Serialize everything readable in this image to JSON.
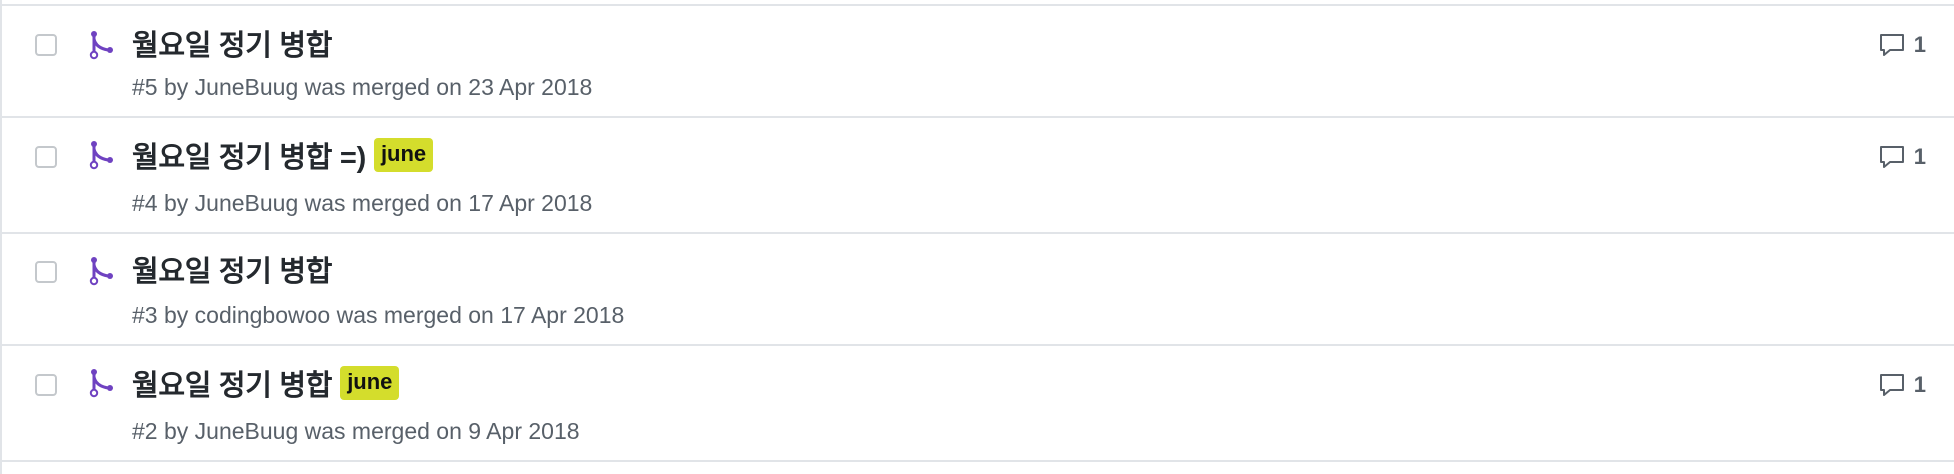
{
  "pull_requests": [
    {
      "title": "월요일 정기 병합",
      "label": "",
      "meta": "#5 by JuneBuug was merged on 23 Apr 2018",
      "comments": "1"
    },
    {
      "title": "월요일 정기 병합 =)",
      "label": "june",
      "meta": "#4 by JuneBuug was merged on 17 Apr 2018",
      "comments": "1"
    },
    {
      "title": "월요일 정기 병합",
      "label": "",
      "meta": "#3 by codingbowoo was merged on 17 Apr 2018",
      "comments": ""
    },
    {
      "title": "월요일 정기 병합",
      "label": "june",
      "meta": "#2 by JuneBuug was merged on 9 Apr 2018",
      "comments": "1"
    }
  ],
  "colors": {
    "merged_icon": "#6f42c1",
    "label_june": "#d4dd2c"
  },
  "icons": {
    "merged": "git-merge-icon",
    "comment": "comment-icon"
  }
}
